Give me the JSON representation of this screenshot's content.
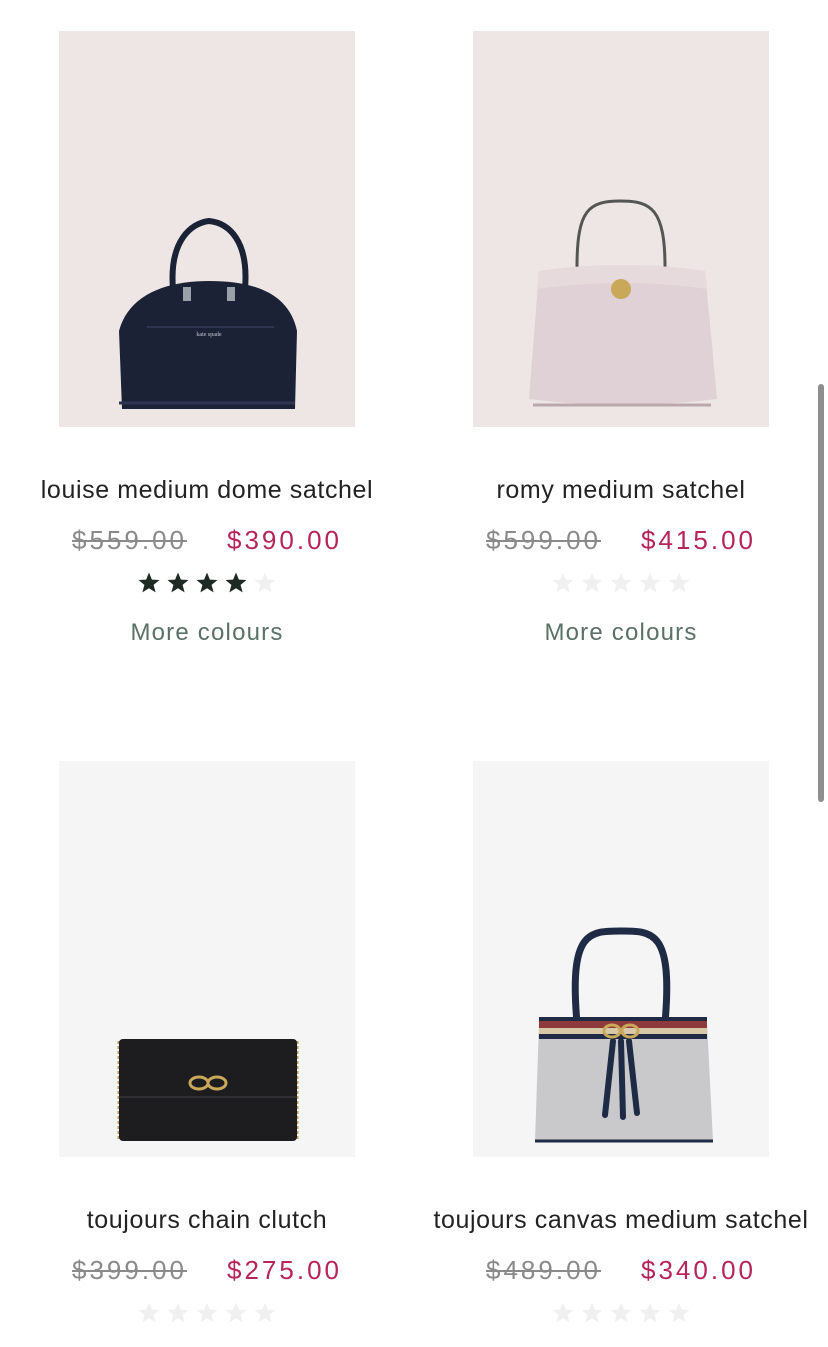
{
  "products": [
    {
      "name": "louise medium dome satchel",
      "price_original": "$559.00",
      "price_sale": "$390.00",
      "rating": 4,
      "rating_max": 5,
      "more_colours": "More colours",
      "image": {
        "description_icon": "dome-satchel-navy-image",
        "background": "#ede6e5",
        "bag_color": "#1c2236"
      }
    },
    {
      "name": "romy medium satchel",
      "price_original": "$599.00",
      "price_sale": "$415.00",
      "rating": 0,
      "rating_max": 5,
      "more_colours": "More colours",
      "image": {
        "description_icon": "top-handle-satchel-pink-image",
        "background": "#ede6e5",
        "bag_color": "#dfd1d5"
      }
    },
    {
      "name": "toujours chain clutch",
      "price_original": "$399.00",
      "price_sale": "$275.00",
      "rating": 0,
      "rating_max": 5,
      "image": {
        "description_icon": "chain-clutch-black-image",
        "background": "#f5f5f5",
        "bag_color": "#1d1d1f"
      }
    },
    {
      "name": "toujours canvas medium satchel",
      "price_original": "$489.00",
      "price_sale": "$340.00",
      "rating": 0,
      "rating_max": 5,
      "image": {
        "description_icon": "canvas-satchel-grey-image",
        "background": "#f5f5f5",
        "bag_color": "#c9c9cb"
      }
    }
  ],
  "colors": {
    "sale_price": "#b5245a",
    "original_price": "#8a8a8a",
    "more_colours_link": "#5a7166",
    "star_filled": "#1f2a24",
    "star_empty": "#f0f0f0"
  }
}
